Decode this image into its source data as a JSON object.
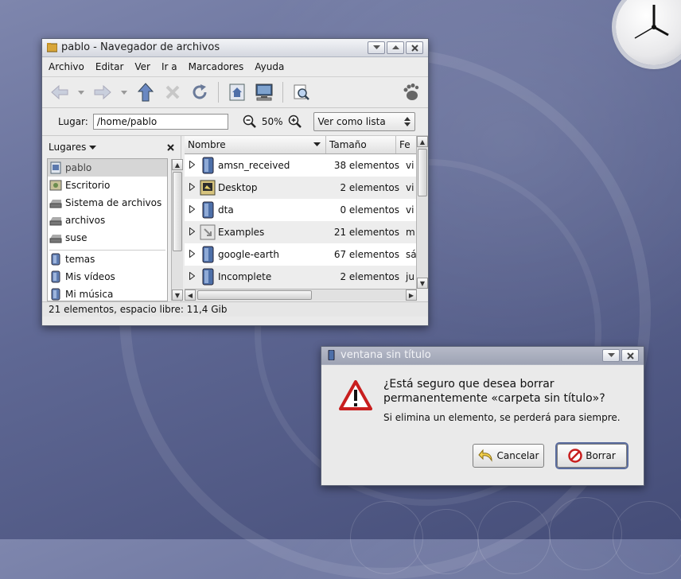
{
  "colors": {
    "desktop_accent": "#5f6894",
    "window_bg": "#eaeaea",
    "selection": "#d6d6d6"
  },
  "file_manager": {
    "title": "pablo - Navegador de archivos",
    "menu": [
      "Archivo",
      "Editar",
      "Ver",
      "Ir a",
      "Marcadores",
      "Ayuda"
    ],
    "toolbar_icons": [
      "back-icon",
      "forward-icon",
      "up-icon",
      "stop-icon",
      "reload-icon",
      "home-icon",
      "computer-icon",
      "search-icon",
      "foot-icon"
    ],
    "location_label": "Lugar:",
    "location_value": "/home/pablo",
    "zoom": "50%",
    "view_mode": "Ver como lista",
    "sidebar": {
      "title": "Lugares",
      "items": [
        {
          "label": "pablo",
          "icon": "home-folder-icon",
          "selected": true
        },
        {
          "label": "Escritorio",
          "icon": "desktop-icon"
        },
        {
          "label": "Sistema de archivos",
          "icon": "drive-icon"
        },
        {
          "label": "archivos",
          "icon": "drive-icon"
        },
        {
          "label": "suse",
          "icon": "drive-icon"
        },
        {
          "label": "temas",
          "icon": "folder-icon"
        },
        {
          "label": "Mis vídeos",
          "icon": "folder-icon"
        },
        {
          "label": "Mi música",
          "icon": "folder-icon"
        }
      ]
    },
    "columns": [
      "Nombre",
      "Tamaño",
      "Fe"
    ],
    "rows": [
      {
        "name": "amsn_received",
        "size": "38 elementos",
        "date": "vi",
        "icon": "folder-icon"
      },
      {
        "name": "Desktop",
        "size": "2 elementos",
        "date": "vi",
        "icon": "desktop-folder-icon"
      },
      {
        "name": "dta",
        "size": "0 elementos",
        "date": "vi",
        "icon": "folder-icon"
      },
      {
        "name": "Examples",
        "size": "21 elementos",
        "date": "m",
        "icon": "link-folder-icon"
      },
      {
        "name": "google-earth",
        "size": "67 elementos",
        "date": "sá",
        "icon": "folder-icon"
      },
      {
        "name": "Incomplete",
        "size": "2 elementos",
        "date": "ju",
        "icon": "folder-icon"
      }
    ],
    "status": "21 elementos, espacio libre: 11,4 Gib"
  },
  "dialog": {
    "title": "ventana sin título",
    "heading_line1": "¿Está seguro que desea borrar",
    "heading_line2": "permanentemente «carpeta sin título»?",
    "message": "Si elimina un elemento, se perderá para siempre.",
    "cancel_label": "Cancelar",
    "delete_label": "Borrar"
  }
}
